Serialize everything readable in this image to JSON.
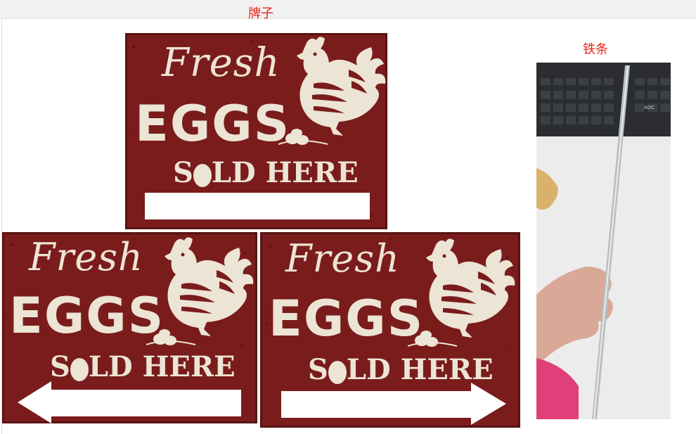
{
  "labels": {
    "sign": "牌子",
    "rod": "铁条"
  },
  "signs": [
    {
      "variant": "blank-panel",
      "line1": "Fresh",
      "line2": "EGGS",
      "line3_prefix": "S",
      "line3_suffix": "LD HERE"
    },
    {
      "variant": "arrow-left",
      "line1": "Fresh",
      "line2": "EGGS",
      "line3_prefix": "S",
      "line3_suffix": "LD HERE"
    },
    {
      "variant": "arrow-right",
      "line1": "Fresh",
      "line2": "EGGS",
      "line3_prefix": "S",
      "line3_suffix": "LD HERE"
    }
  ],
  "photo": {
    "keyboard_brand": "AOC"
  },
  "colors": {
    "sign_red": "#7a1c1c",
    "sign_cream": "#ece4d4",
    "label_red": "#e8231c"
  }
}
